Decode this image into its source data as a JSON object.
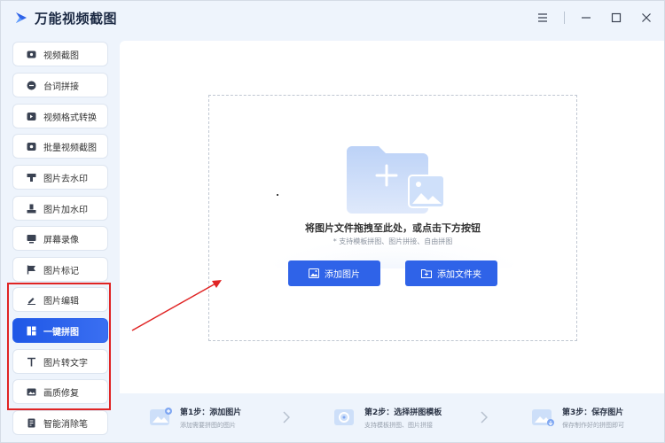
{
  "app": {
    "title": "万能视频截图",
    "brand_color": "#2f63e8"
  },
  "window_controls": [
    "menu-icon",
    "minimize-icon",
    "maximize-icon",
    "close-icon"
  ],
  "sidebar": {
    "items": [
      {
        "label": "视频截图",
        "icon": "video-capture-icon"
      },
      {
        "label": "台词拼接",
        "icon": "subtitle-icon"
      },
      {
        "label": "视频格式转换",
        "icon": "convert-icon"
      },
      {
        "label": "批量视频截图",
        "icon": "batch-icon"
      },
      {
        "label": "图片去水印",
        "icon": "stamp-icon"
      },
      {
        "label": "图片加水印",
        "icon": "stamp-add-icon"
      },
      {
        "label": "屏幕录像",
        "icon": "record-icon"
      },
      {
        "label": "图片标记",
        "icon": "flag-icon"
      },
      {
        "label": "图片编辑",
        "icon": "pencil-icon"
      },
      {
        "label": "一键拼图",
        "icon": "grid-icon",
        "active": true
      },
      {
        "label": "图片转文字",
        "icon": "text-icon"
      },
      {
        "label": "画质修复",
        "icon": "image-icon"
      },
      {
        "label": "智能消除笔",
        "icon": "eraser-icon"
      }
    ]
  },
  "dropzone": {
    "title": "将图片文件拖拽至此处，或点击下方按钮",
    "subtitle": "* 支持模板拼图、图片拼接、自由拼图",
    "add_image_label": "添加图片",
    "add_folder_label": "添加文件夹"
  },
  "steps": [
    {
      "title": "第1步：添加图片",
      "desc": "添加需要拼图的图片"
    },
    {
      "title": "第2步：选择拼图模板",
      "desc": "支持模板拼图、图片拼接"
    },
    {
      "title": "第3步：保存图片",
      "desc": "保存制作好的拼图即可"
    }
  ]
}
